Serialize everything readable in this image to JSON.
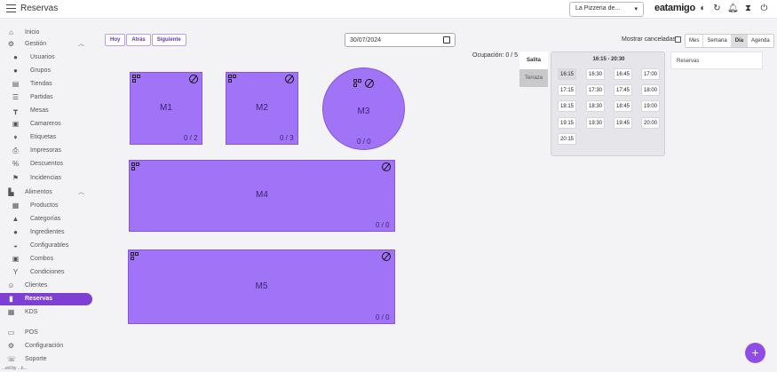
{
  "header": {
    "title": "Reservas",
    "store_selector": "La Pizzeria de...",
    "brand": "eatamigo",
    "icons": [
      "menu-icon",
      "half-circle-icon",
      "contrast-icon",
      "refresh-icon",
      "bell-icon",
      "hourglass-icon",
      "power-icon"
    ]
  },
  "sidebar": {
    "items": [
      {
        "label": "Inicio",
        "icon": "home-icon"
      },
      {
        "label": "Gestión",
        "icon": "store-icon"
      },
      {
        "label": "Usuarios",
        "icon": "user-icon"
      },
      {
        "label": "Grupos",
        "icon": "group-icon"
      },
      {
        "label": "Tiendas",
        "icon": "shop-icon"
      },
      {
        "label": "Partidas",
        "icon": "stack-icon"
      },
      {
        "label": "Mesas",
        "icon": "table-icon"
      },
      {
        "label": "Camareros",
        "icon": "waiter-icon"
      },
      {
        "label": "Etiquetas",
        "icon": "tag-icon"
      },
      {
        "label": "Impresoras",
        "icon": "printer-icon"
      },
      {
        "label": "Descuentos",
        "icon": "percent-icon"
      },
      {
        "label": "Incidencias",
        "icon": "flag-icon"
      },
      {
        "label": "Alimentos",
        "icon": "factory-icon"
      },
      {
        "label": "Productos",
        "icon": "box-icon"
      },
      {
        "label": "Categorías",
        "icon": "categories-icon"
      },
      {
        "label": "Ingredientes",
        "icon": "cookie-icon"
      },
      {
        "label": "Configurables",
        "icon": "bowl-icon"
      },
      {
        "label": "Combos",
        "icon": "combo-icon"
      },
      {
        "label": "Condiciones",
        "icon": "fork-icon"
      },
      {
        "label": "Clientes",
        "icon": "smile-icon"
      },
      {
        "label": "Reservas",
        "icon": "book-icon"
      },
      {
        "label": "KDS",
        "icon": "grid-icon"
      },
      {
        "label": "POS",
        "icon": "pos-icon"
      },
      {
        "label": "Configuración",
        "icon": "gear-icon"
      },
      {
        "label": "Soporte",
        "icon": "support-icon"
      }
    ],
    "footer_note": "...ed by ...k..."
  },
  "toolbar": {
    "today": "Hoy",
    "back": "Atrás",
    "next": "Siguiente",
    "date": "30/07/2024",
    "show_cancelled": "Mostrar canceladas",
    "views": [
      "Mes",
      "Semana",
      "Día",
      "Agenda"
    ],
    "active_view": "Día"
  },
  "occupancy": "Ocupación: 0 / 5",
  "tables": [
    {
      "name": "M1",
      "occ": "0 / 2"
    },
    {
      "name": "M2",
      "occ": "0 / 3"
    },
    {
      "name": "M3",
      "occ": "0 / 0"
    },
    {
      "name": "M4",
      "occ": "0 / 0"
    },
    {
      "name": "M5",
      "occ": "0 / 0"
    }
  ],
  "zones": [
    "Salita",
    "Terraza"
  ],
  "active_zone": "Salita",
  "slots": {
    "title": "16:15 - 20:30",
    "times": [
      "16:15",
      "16:30",
      "16:45",
      "17:00",
      "17:15",
      "17:30",
      "17:45",
      "18:00",
      "18:15",
      "18:30",
      "18:45",
      "19:00",
      "19:15",
      "19:30",
      "19:45",
      "20:00",
      "20:15"
    ],
    "selected": "16:15"
  },
  "reservations_panel": "Reservas",
  "fab": "+"
}
